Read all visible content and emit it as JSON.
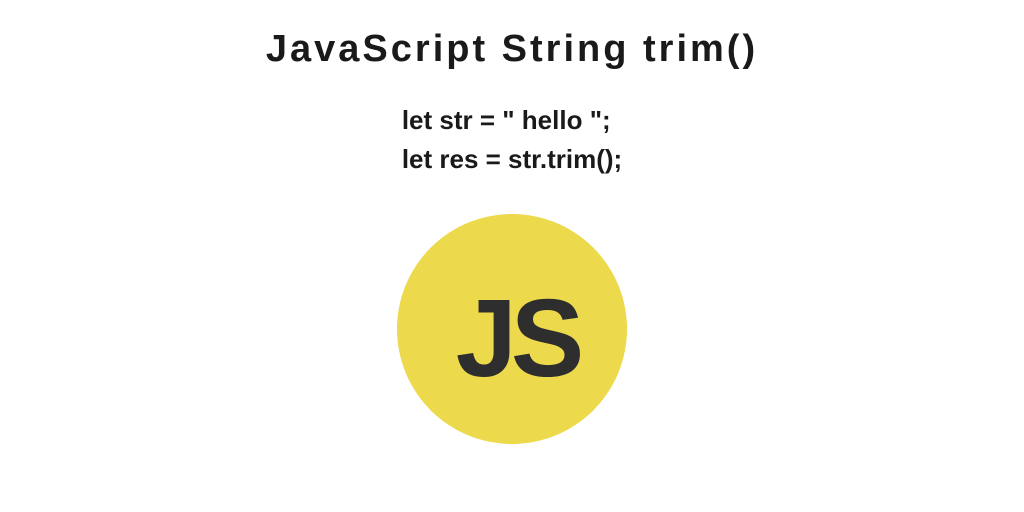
{
  "title": "JavaScript String trim()",
  "code": {
    "line1": "let str = \" hello \";",
    "line2": "let res = str.trim();"
  },
  "logo": {
    "text": "JS",
    "bg_color": "#ecd94c",
    "fg_color": "#2e2e2e"
  }
}
